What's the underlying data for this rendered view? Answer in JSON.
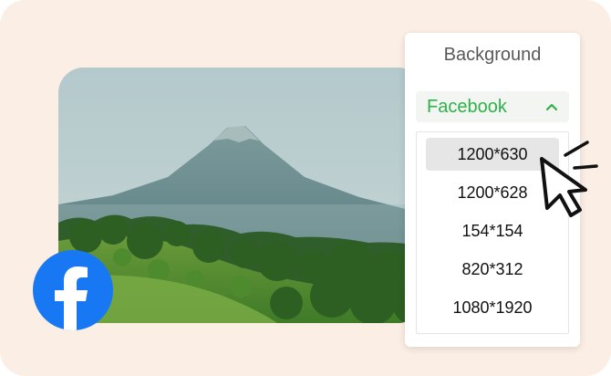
{
  "panel": {
    "title": "Background",
    "platform_select": {
      "value": "Facebook",
      "icon": "chevron-up-icon",
      "accent_color": "#2fb14a"
    },
    "size_options": [
      "1200*630",
      "1200*628",
      "154*154",
      "820*312",
      "1080*1920"
    ],
    "highlighted_option": "1200*630"
  },
  "badge": {
    "icon": "facebook-logo-icon",
    "color": "#1877f2"
  },
  "background_color": "#fbeee4"
}
